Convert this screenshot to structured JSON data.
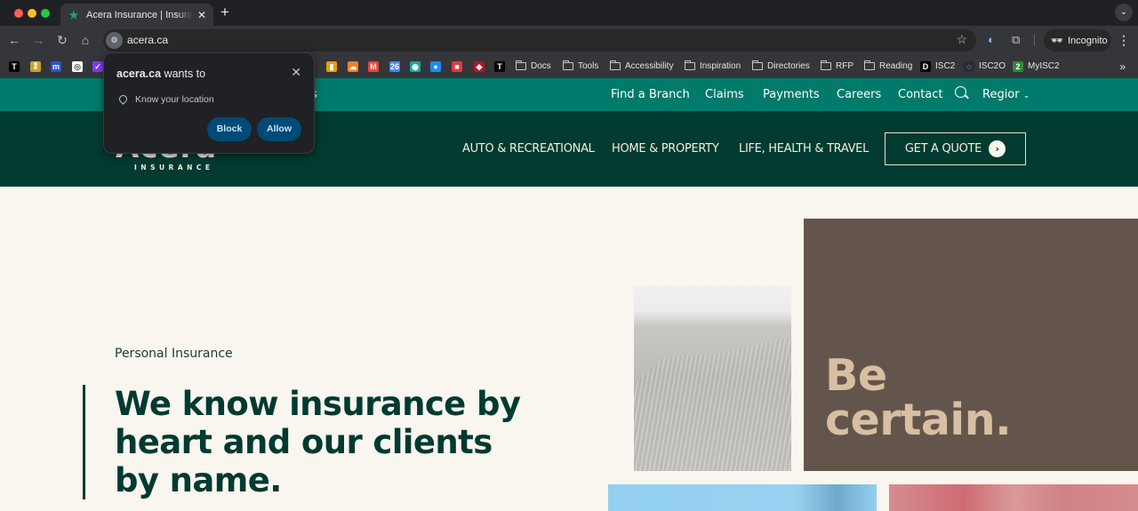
{
  "browser": {
    "tab": {
      "title": "Acera Insurance | Insurance for",
      "favicon": "acera-star-icon"
    },
    "new_tab_icon": "+",
    "tab_menu_icon": "⌄",
    "address": {
      "url": "acera.ca"
    },
    "incognito_label": "Incognito",
    "bookmarks": [
      {
        "type": "icon",
        "label": "",
        "icon": "t-brand-icon",
        "color": "#000000",
        "glyph": "T"
      },
      {
        "type": "icon",
        "label": "",
        "icon": "yellow-pin-icon",
        "color": "#c9a227",
        "glyph": "⁑"
      },
      {
        "type": "icon",
        "label": "",
        "icon": "miro-icon",
        "color": "#2b54d0",
        "glyph": "m"
      },
      {
        "type": "icon",
        "label": "",
        "icon": "openai-icon",
        "color": "#ffffff",
        "glyph": "◎"
      },
      {
        "type": "icon",
        "label": "",
        "icon": "checkmark-app-icon",
        "color": "#7d3cf0",
        "glyph": "✓"
      },
      {
        "type": "icon",
        "label": "",
        "icon": "analytics-icon",
        "color": "#f29900",
        "glyph": "▮"
      },
      {
        "type": "icon",
        "label": "",
        "icon": "cloudflare-icon",
        "color": "#f38020",
        "glyph": "☁"
      },
      {
        "type": "icon",
        "label": "",
        "icon": "gmail-icon",
        "color": "#ea4335",
        "glyph": "M"
      },
      {
        "type": "icon",
        "label": "",
        "icon": "calendar-icon",
        "color": "#4285f4",
        "glyph": "26"
      },
      {
        "type": "icon",
        "label": "",
        "icon": "fingerprint-icon",
        "color": "#1aa7a1",
        "glyph": "◉"
      },
      {
        "type": "icon",
        "label": "",
        "icon": "blue-dot-icon",
        "color": "#1a8cff",
        "glyph": "●"
      },
      {
        "type": "icon",
        "label": "",
        "icon": "red-square-icon",
        "color": "#e03a3e",
        "glyph": "■"
      },
      {
        "type": "icon",
        "label": "",
        "icon": "red-diamond-icon",
        "color": "#b3142b",
        "glyph": "◆"
      },
      {
        "type": "icon",
        "label": "",
        "icon": "t-brand-icon",
        "color": "#000000",
        "glyph": "T"
      },
      {
        "type": "folder",
        "label": "Docs"
      },
      {
        "type": "folder",
        "label": "Tools"
      },
      {
        "type": "folder",
        "label": "Accessibility"
      },
      {
        "type": "folder",
        "label": "Inspiration"
      },
      {
        "type": "folder",
        "label": "Directories"
      },
      {
        "type": "folder",
        "label": "RFP"
      },
      {
        "type": "folder",
        "label": "Reading"
      },
      {
        "type": "site",
        "label": "ISC2",
        "icon": "d2l-icon",
        "color": "#000000",
        "glyph": "D"
      },
      {
        "type": "site",
        "label": "ISC2O",
        "icon": "isc2-ring-icon",
        "color": "#2b2d35",
        "glyph": "◌"
      },
      {
        "type": "site",
        "label": "MyISC2",
        "icon": "green-2-icon",
        "color": "#2e8b35",
        "glyph": "2"
      }
    ],
    "overflow_icon": "»"
  },
  "permission_popup": {
    "site": "acera.ca",
    "title_suffix": " wants to",
    "permission": "Know your location",
    "block_label": "Block",
    "allow_label": "Allow",
    "close_icon": "✕"
  },
  "site": {
    "utility_nav": [
      {
        "label": "Find a Branch"
      },
      {
        "label": "Claims"
      },
      {
        "label": "Payments"
      },
      {
        "label": "Careers"
      },
      {
        "label": "Contact"
      }
    ],
    "utility_partial": "s",
    "region_label": "Regior",
    "logo": {
      "name": "Acera",
      "tagline": "INSURANCE"
    },
    "main_nav": [
      {
        "label": "AUTO & RECREATIONAL"
      },
      {
        "label": "HOME & PROPERTY"
      },
      {
        "label": "LIFE, HEALTH & TRAVEL"
      }
    ],
    "cta_label": "GET A QUOTE",
    "hero": {
      "eyebrow": "Personal Insurance",
      "title": "We know insurance by heart and our clients by name."
    },
    "tile": {
      "line1": "Be",
      "line2": "certain."
    }
  },
  "colors": {
    "utility_bar": "#007a6a",
    "main_nav": "#013a30",
    "page_bg": "#f9f5ef",
    "tile_bg": "#63554c",
    "tile_text": "#d8bfa2",
    "popup_button": "#004a77"
  }
}
